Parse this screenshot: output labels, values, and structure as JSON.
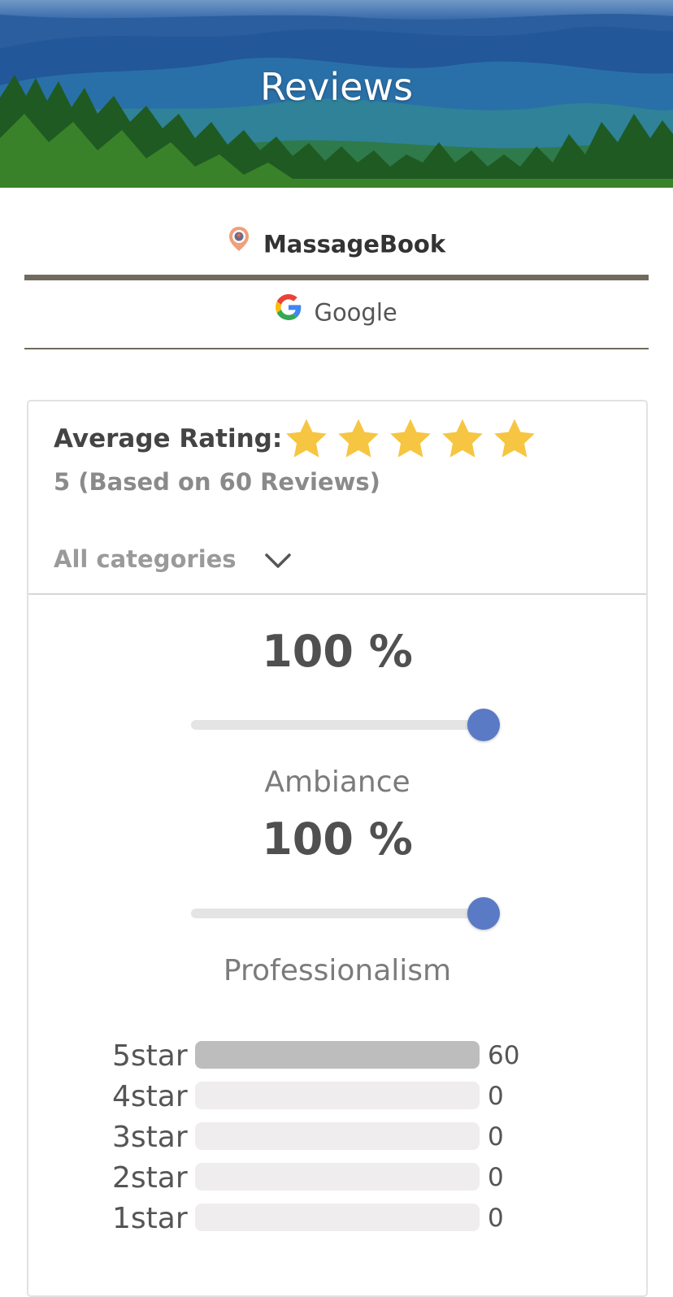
{
  "hero": {
    "title": "Reviews"
  },
  "tabs": [
    {
      "label": "MassageBook",
      "active": true,
      "icon": "massagebook-logo-icon"
    },
    {
      "label": "Google",
      "active": false,
      "icon": "google-logo-icon"
    }
  ],
  "summary": {
    "average_label": "Average Rating:",
    "star_count": 5,
    "based_on": "5 (Based on 60 Reviews)",
    "star_color": "#f6c642"
  },
  "category_filter": {
    "value": "All categories",
    "icon": "chevron-down-icon"
  },
  "metrics": [
    {
      "percent_text": "100 %",
      "value": 1.0,
      "name": "Ambiance"
    },
    {
      "percent_text": "100 %",
      "value": 1.0,
      "name": "Professionalism"
    }
  ],
  "distribution": [
    {
      "label": "5star",
      "count": "60",
      "fraction": 1.0
    },
    {
      "label": "4star",
      "count": "0",
      "fraction": 0
    },
    {
      "label": "3star",
      "count": "0",
      "fraction": 0
    },
    {
      "label": "2star",
      "count": "0",
      "fraction": 0
    },
    {
      "label": "1star",
      "count": "0",
      "fraction": 0
    }
  ],
  "colors": {
    "slider_thumb": "#5a7ac6",
    "tab_underline": "#706b5e",
    "bar_fill": "#bdbdbd",
    "bar_track": "#efeded"
  }
}
